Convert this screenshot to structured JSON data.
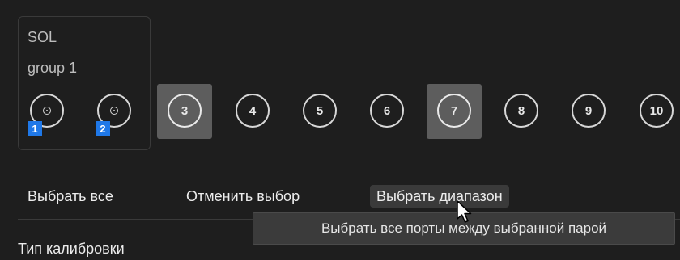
{
  "group": {
    "name": "SOL",
    "subname": "group 1",
    "ports": [
      {
        "badge": "1"
      },
      {
        "badge": "2"
      }
    ]
  },
  "ports": [
    "3",
    "4",
    "5",
    "6",
    "7",
    "8",
    "9",
    "10"
  ],
  "selected_ports": [
    "3",
    "7"
  ],
  "actions": {
    "select_all": "Выбрать все",
    "deselect": "Отменить выбор",
    "select_range": "Выбрать диапазон"
  },
  "tooltip": "Выбрать все порты между выбранной парой",
  "section_title": "Тип калибровки",
  "colors": {
    "background": "#1e1e1e",
    "badge": "#1f78e8",
    "selected": "#5d5d5d"
  }
}
